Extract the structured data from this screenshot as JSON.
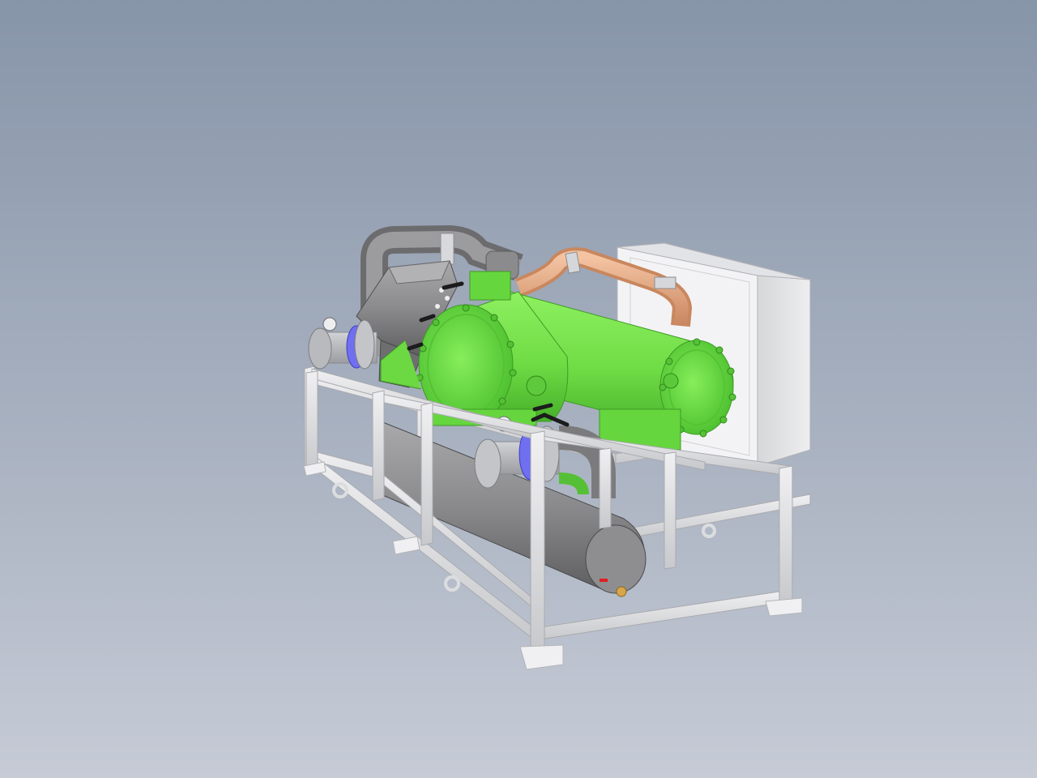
{
  "viewport": {
    "background_top": "#8795a9",
    "background_bottom": "#c6cbd6"
  },
  "model": {
    "colors": {
      "frame": "#e4e4e6",
      "frame_shadow": "#b8b9bc",
      "vessel_green": "#73e04a",
      "vessel_green_dark": "#4cb82c",
      "vessel_grey": "#8a8a8c",
      "copper_pipe": "#e8aa82",
      "valve_blue": "#6f6ff0",
      "panel": "#e9e9eb",
      "handle": "#1c1c1c"
    }
  }
}
